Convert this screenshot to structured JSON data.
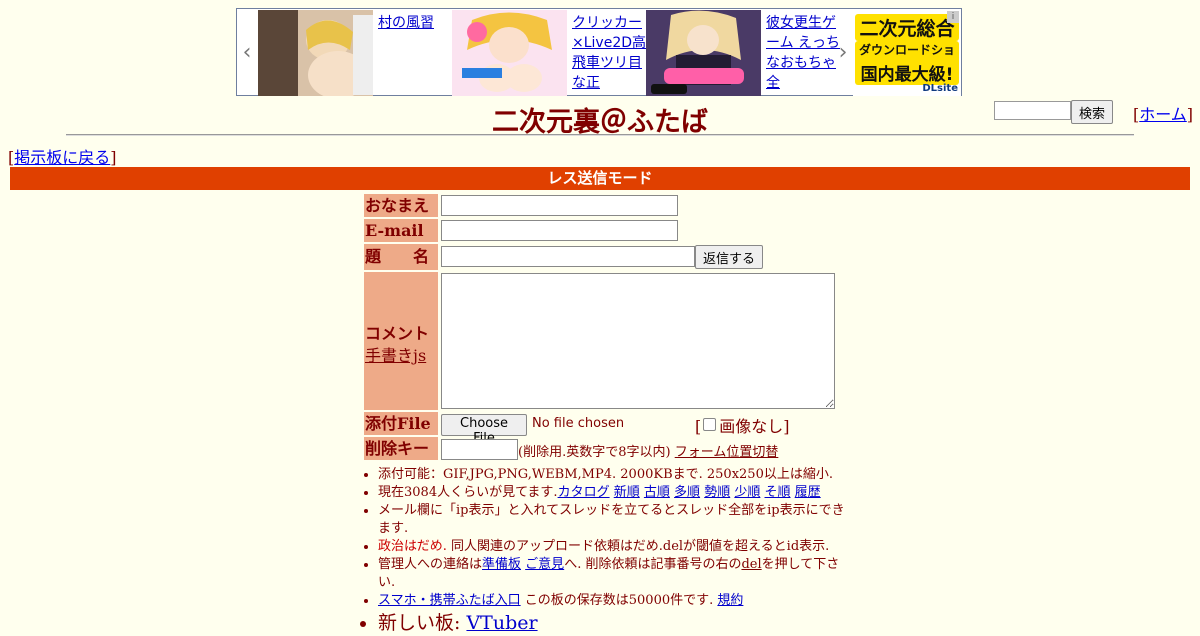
{
  "ads": {
    "items": [
      {
        "link_text": "村の風習"
      },
      {
        "link_text": "クリッカー×Live2D高飛車ツリ目な正"
      },
      {
        "link_text": "彼女更生ゲーム えっちなおもちゃ全"
      }
    ],
    "dlsite": {
      "line1": "二次元総合",
      "line2": "ダウンロードショップ",
      "line3": "国内最大級!",
      "brand": "DLsite"
    }
  },
  "header": {
    "title": "二次元裏＠ふたば",
    "search_button": "検索",
    "home_link": "ホーム",
    "back_link": "掲示板に戻る"
  },
  "mode_bar": "レス送信モード",
  "form": {
    "name_label": "おなまえ",
    "email_label": "E-mail",
    "subject_label": "題　　名",
    "submit_button": "返信する",
    "comment_label": "コメント",
    "handwriting_link": "手書きjs",
    "file_label": "添付File",
    "choose_file_button": "Choose File",
    "file_status": "No file chosen",
    "no_image_label": "画像なし",
    "delkey_label": "削除キー",
    "delkey_note": "(削除用.英数字で8字以内)",
    "form_position_link": "フォーム位置切替"
  },
  "info": {
    "attach": "添付可能：GIF,JPG,PNG,WEBM,MP4. 2000KBまで. 250x250以上は縮小.",
    "viewers_prefix": "現在3084人くらいが見てます.",
    "catalog_links": [
      "カタログ",
      "新順",
      "古順",
      "多順",
      "勢順",
      "少順",
      "そ順",
      "履歴"
    ],
    "ip_notice": "メール欄に「ip表示」と入れてスレッドを立てるとスレッド全部をip表示にできます.",
    "politics_red": "政治はだめ.",
    "politics_rest": " 同人関連のアップロード依頼はだめ.delが閾値を超えるとid表示.",
    "admin_prefix": "管理人への連絡は",
    "admin_link1": "準備板",
    "admin_link2": "ご意見",
    "admin_mid": "へ. 削除依頼は記事番号の右の",
    "admin_del": "del",
    "admin_suffix": "を押して下さい.",
    "mobile_link": "スマホ・携帯ふたば入口",
    "storage_text": " この板の保存数は50000件です.",
    "rules_link": "規約",
    "new_board_prefix": "新しい板: ",
    "new_board_link": "VTuber"
  }
}
